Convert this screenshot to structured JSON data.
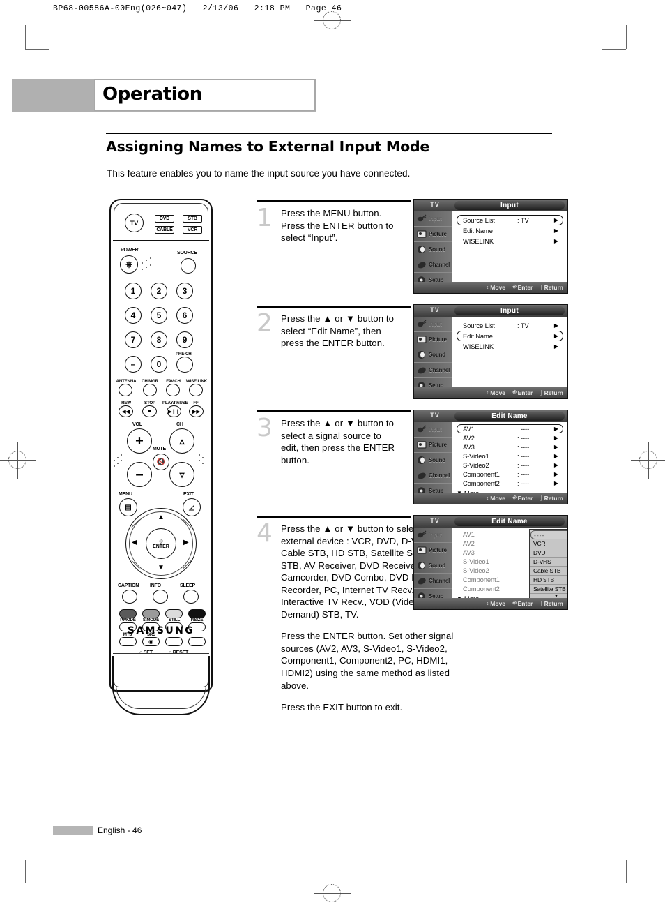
{
  "page_header": "BP68-00586A-00Eng(026~047)   2/13/06   2:18 PM   Page 46",
  "chapter": {
    "title": "Operation"
  },
  "section": {
    "title": "Assigning Names to External Input Mode",
    "intro": "This feature enables you to name the input source you have connected."
  },
  "remote": {
    "brand": "SAMSUNG",
    "mode_tv": "TV",
    "mode_dvd": "DVD",
    "mode_stb": "STB",
    "mode_cable": "CABLE",
    "mode_vcr": "VCR",
    "power_label": "POWER",
    "source_label": "SOURCE",
    "keys": [
      "1",
      "2",
      "3",
      "4",
      "5",
      "6",
      "7",
      "8",
      "9",
      "–",
      "0"
    ],
    "prech": "PRE-CH",
    "row_antenna": [
      "ANTENNA",
      "CH MGR",
      "FAV.CH",
      "WISE LINK"
    ],
    "transport": [
      "REW",
      "STOP",
      "PLAY/PAUSE",
      "FF"
    ],
    "vol_label": "VOL",
    "ch_label": "CH",
    "mute_label": "MUTE",
    "menu_label": "MENU",
    "exit_label": "EXIT",
    "enter_label": "ENTER",
    "row_caption": [
      "CAPTION",
      "INFO",
      "SLEEP"
    ],
    "row_mode": [
      "P.MODE",
      "S.MODE",
      "STILL",
      "P.SIZE"
    ],
    "row_mts": [
      "MTS",
      "SRS"
    ],
    "set_label": "SET",
    "reset_label": "RESET"
  },
  "steps": [
    {
      "number": "1",
      "paragraphs": [
        "Press the MENU button.\nPress the ENTER button to\nselect “Input”."
      ]
    },
    {
      "number": "2",
      "paragraphs": [
        "Press the ▲ or ▼ button to\nselect “Edit Name”, then\npress the ENTER button."
      ]
    },
    {
      "number": "3",
      "paragraphs": [
        "Press the ▲ or ▼ button to\nselect a signal source to\nedit, then press the ENTER\nbutton."
      ]
    },
    {
      "number": "4",
      "paragraphs": [
        "Press the ▲ or ▼ button to select the external device : VCR, DVD, D-VHS, Cable STB, HD STB, Satellite STB, PVR STB, AV Receiver, DVD Receiver, Game, Camcorder, DVD Combo, DVD HDD Recorder, PC, Internet TV Recv., Interactive TV Recv., VOD (Video On Demand) STB, TV.",
        "Press the ENTER button. Set other signal sources (AV2, AV3, S-Video1, S-Video2, Component1, Component2, PC, HDMI1, HDMI2) using the same method as listed above.",
        "Press the EXIT button to exit."
      ]
    }
  ],
  "osd": {
    "source_label": "TV",
    "sidebar": [
      {
        "label": "Input",
        "icon": "input-icon"
      },
      {
        "label": "Picture",
        "icon": "picture-icon"
      },
      {
        "label": "Sound",
        "icon": "sound-icon"
      },
      {
        "label": "Channel",
        "icon": "channel-icon"
      },
      {
        "label": "Setup",
        "icon": "setup-icon"
      }
    ],
    "bottom": {
      "move": "Move",
      "enter": "Enter",
      "return": "Return"
    },
    "screens": [
      {
        "title": "Input",
        "rows": [
          {
            "name": "Source List",
            "value": ": TV",
            "selected": true
          },
          {
            "name": "Edit Name",
            "value": "",
            "selected": false
          },
          {
            "name": "WISELINK",
            "value": "",
            "selected": false
          }
        ]
      },
      {
        "title": "Input",
        "rows": [
          {
            "name": "Source List",
            "value": ": TV",
            "selected": false
          },
          {
            "name": "Edit Name",
            "value": "",
            "selected": true
          },
          {
            "name": "WISELINK",
            "value": "",
            "selected": false
          }
        ]
      },
      {
        "title": "Edit Name",
        "more": "More",
        "rows": [
          {
            "name": "AV1",
            "value": ": ----",
            "selected": true
          },
          {
            "name": "AV2",
            "value": ": ----",
            "selected": false
          },
          {
            "name": "AV3",
            "value": ": ----",
            "selected": false
          },
          {
            "name": "S-Video1",
            "value": ": ----",
            "selected": false
          },
          {
            "name": "S-Video2",
            "value": ": ----",
            "selected": false
          },
          {
            "name": "Component1",
            "value": ": ----",
            "selected": false
          },
          {
            "name": "Component2",
            "value": ": ----",
            "selected": false
          }
        ]
      },
      {
        "title": "Edit Name",
        "more": "More",
        "rows": [
          {
            "name": "AV1",
            "value": "",
            "selected": false
          },
          {
            "name": "AV2",
            "value": "",
            "selected": false
          },
          {
            "name": "AV3",
            "value": "",
            "selected": false
          },
          {
            "name": "S-Video1",
            "value": "",
            "selected": false
          },
          {
            "name": "S-Video2",
            "value": "",
            "selected": false
          },
          {
            "name": "Component1",
            "value": "",
            "selected": false
          },
          {
            "name": "Component2",
            "value": "",
            "selected": false
          }
        ],
        "dropdown": [
          "----",
          "VCR",
          "DVD",
          "D-VHS",
          "Cable STB",
          "HD STB",
          "Satellite STB"
        ]
      }
    ]
  },
  "footer": {
    "page_label": "English - 46"
  }
}
